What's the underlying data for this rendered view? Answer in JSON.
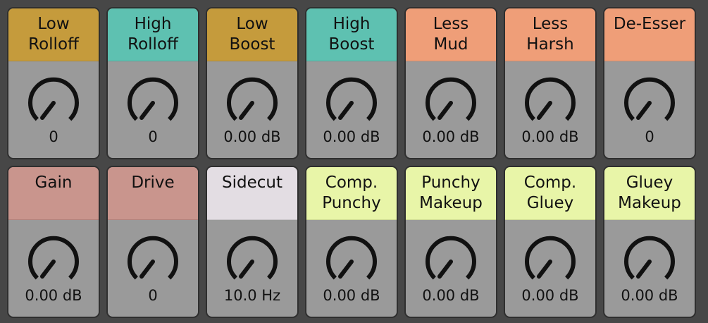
{
  "colors": {
    "background": "#474747",
    "card_body": "#9a9a9a",
    "gold": "#c59b3c",
    "teal": "#5ec1b1",
    "salmon": "#ef9e78",
    "rose": "#c9958d",
    "lavender": "#e3dde3",
    "lime": "#e8f5a8",
    "knob": "#111111"
  },
  "knob_icon": "knob-icon",
  "controls": [
    {
      "id": "low-rolloff",
      "label": "Low\nRolloff",
      "value": "0",
      "color": "#c59b3c"
    },
    {
      "id": "high-rolloff",
      "label": "High\nRolloff",
      "value": "0",
      "color": "#5ec1b1"
    },
    {
      "id": "low-boost",
      "label": "Low\nBoost",
      "value": "0.00 dB",
      "color": "#c59b3c"
    },
    {
      "id": "high-boost",
      "label": "High\nBoost",
      "value": "0.00 dB",
      "color": "#5ec1b1"
    },
    {
      "id": "less-mud",
      "label": "Less\nMud",
      "value": "0.00 dB",
      "color": "#ef9e78"
    },
    {
      "id": "less-harsh",
      "label": "Less\nHarsh",
      "value": "0.00 dB",
      "color": "#ef9e78"
    },
    {
      "id": "de-esser",
      "label": "De-Esser",
      "value": "0",
      "color": "#ef9e78"
    },
    {
      "id": "gain",
      "label": "Gain",
      "value": "0.00 dB",
      "color": "#c9958d"
    },
    {
      "id": "drive",
      "label": "Drive",
      "value": "0",
      "color": "#c9958d"
    },
    {
      "id": "sidecut",
      "label": "Sidecut",
      "value": "10.0 Hz",
      "color": "#e3dde3"
    },
    {
      "id": "comp-punchy",
      "label": "Comp.\nPunchy",
      "value": "0.00 dB",
      "color": "#e8f5a8"
    },
    {
      "id": "punchy-makeup",
      "label": "Punchy\nMakeup",
      "value": "0.00 dB",
      "color": "#e8f5a8"
    },
    {
      "id": "comp-gluey",
      "label": "Comp.\nGluey",
      "value": "0.00 dB",
      "color": "#e8f5a8"
    },
    {
      "id": "gluey-makeup",
      "label": "Gluey\nMakeup",
      "value": "0.00 dB",
      "color": "#e8f5a8"
    }
  ]
}
